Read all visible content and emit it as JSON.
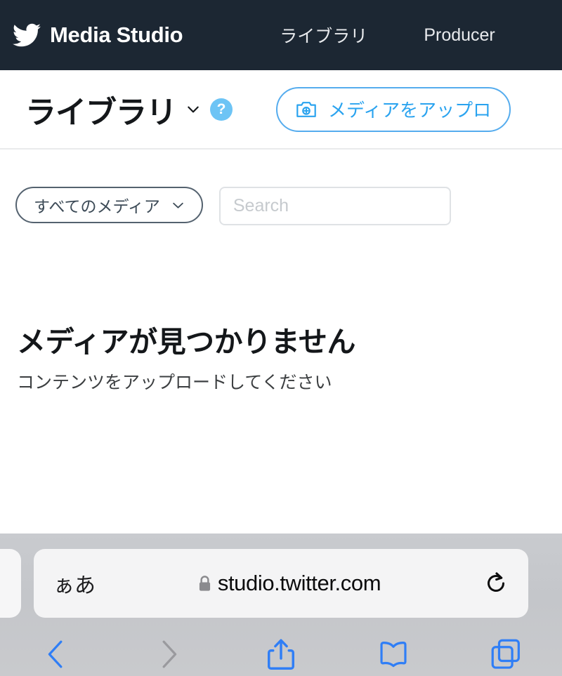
{
  "navbar": {
    "logo_icon": "twitter-bird-icon",
    "brand": "Media Studio",
    "links": [
      {
        "label": "ライブラリ",
        "active": true
      },
      {
        "label": "Producer",
        "active": false
      }
    ],
    "background_color": "#1c2733",
    "text_color": "#ffffff"
  },
  "page_header": {
    "title": "ライブラリ",
    "title_chevron_icon": "chevron-down-icon",
    "help_badge": "?",
    "help_badge_color": "#6dc4f5",
    "upload_button": {
      "label": "メディアをアップロ",
      "icon": "camera-plus-icon",
      "accent_color": "#2aa3ef",
      "border_color": "#55acee"
    }
  },
  "filters": {
    "media_filter": {
      "label": "すべてのメディア",
      "chevron_icon": "chevron-down-icon",
      "border_color": "#54626f"
    },
    "search": {
      "value": "",
      "placeholder": "Search",
      "placeholder_color": "#c6cace"
    }
  },
  "empty_state": {
    "title": "メディアが見つかりません",
    "subtitle": "コンテンツをアップロードしてください"
  },
  "browser": {
    "url_bar": {
      "text_size_button": "ぁあ",
      "lock_icon": "lock-icon",
      "url": "studio.twitter.com",
      "reload_icon": "reload-icon"
    },
    "toolbar": [
      {
        "name": "back",
        "icon": "chevron-left-icon",
        "enabled": true,
        "color": "#2f7ef6"
      },
      {
        "name": "forward",
        "icon": "chevron-right-icon",
        "enabled": false,
        "color": "#9a9a9e"
      },
      {
        "name": "share",
        "icon": "share-icon",
        "enabled": true,
        "color": "#2f7ef6"
      },
      {
        "name": "bookmarks",
        "icon": "book-icon",
        "enabled": true,
        "color": "#2f7ef6"
      },
      {
        "name": "tabs",
        "icon": "tabs-icon",
        "enabled": true,
        "color": "#2f7ef6"
      }
    ],
    "chrome_color": "#c6c8cc"
  }
}
